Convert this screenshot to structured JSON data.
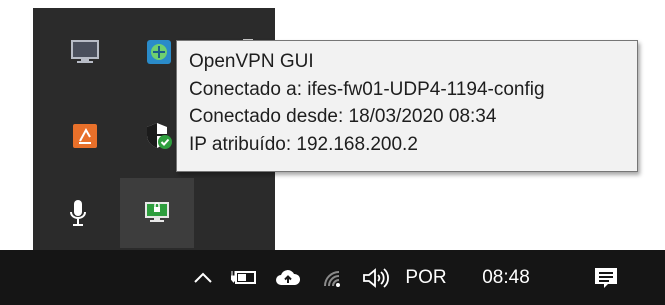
{
  "tooltip": {
    "lines": [
      "OpenVPN GUI",
      "Conectado a: ifes-fw01-UDP4-1194-config",
      "Conectado desde: 18/03/2020 08:34",
      "IP atribuído: 192.168.200.2"
    ]
  },
  "tray_icons": [
    {
      "icon": "monitor-icon"
    },
    {
      "icon": "vpn-app-icon"
    },
    {
      "icon": "network-adapter-icon"
    },
    {
      "icon": "device-icon"
    },
    {
      "icon": "orange-app-icon"
    },
    {
      "icon": "windows-security-shield-icon"
    },
    {
      "icon": "microphone-icon"
    },
    {
      "icon": "openvpn-connected-icon"
    }
  ],
  "taskbar": {
    "language": "POR",
    "time": "08:48",
    "icons": [
      "chevron-up-icon",
      "battery-icon",
      "onedrive-cloud-icon",
      "wifi-icon",
      "volume-icon",
      "notification-center-icon"
    ]
  },
  "colors": {
    "taskbar_bg": "#151515",
    "flyout_bg": "#2b2b2b",
    "tooltip_bg": "#f2f2f2",
    "tooltip_border": "#767676",
    "connected_green": "#2e9e3e"
  }
}
